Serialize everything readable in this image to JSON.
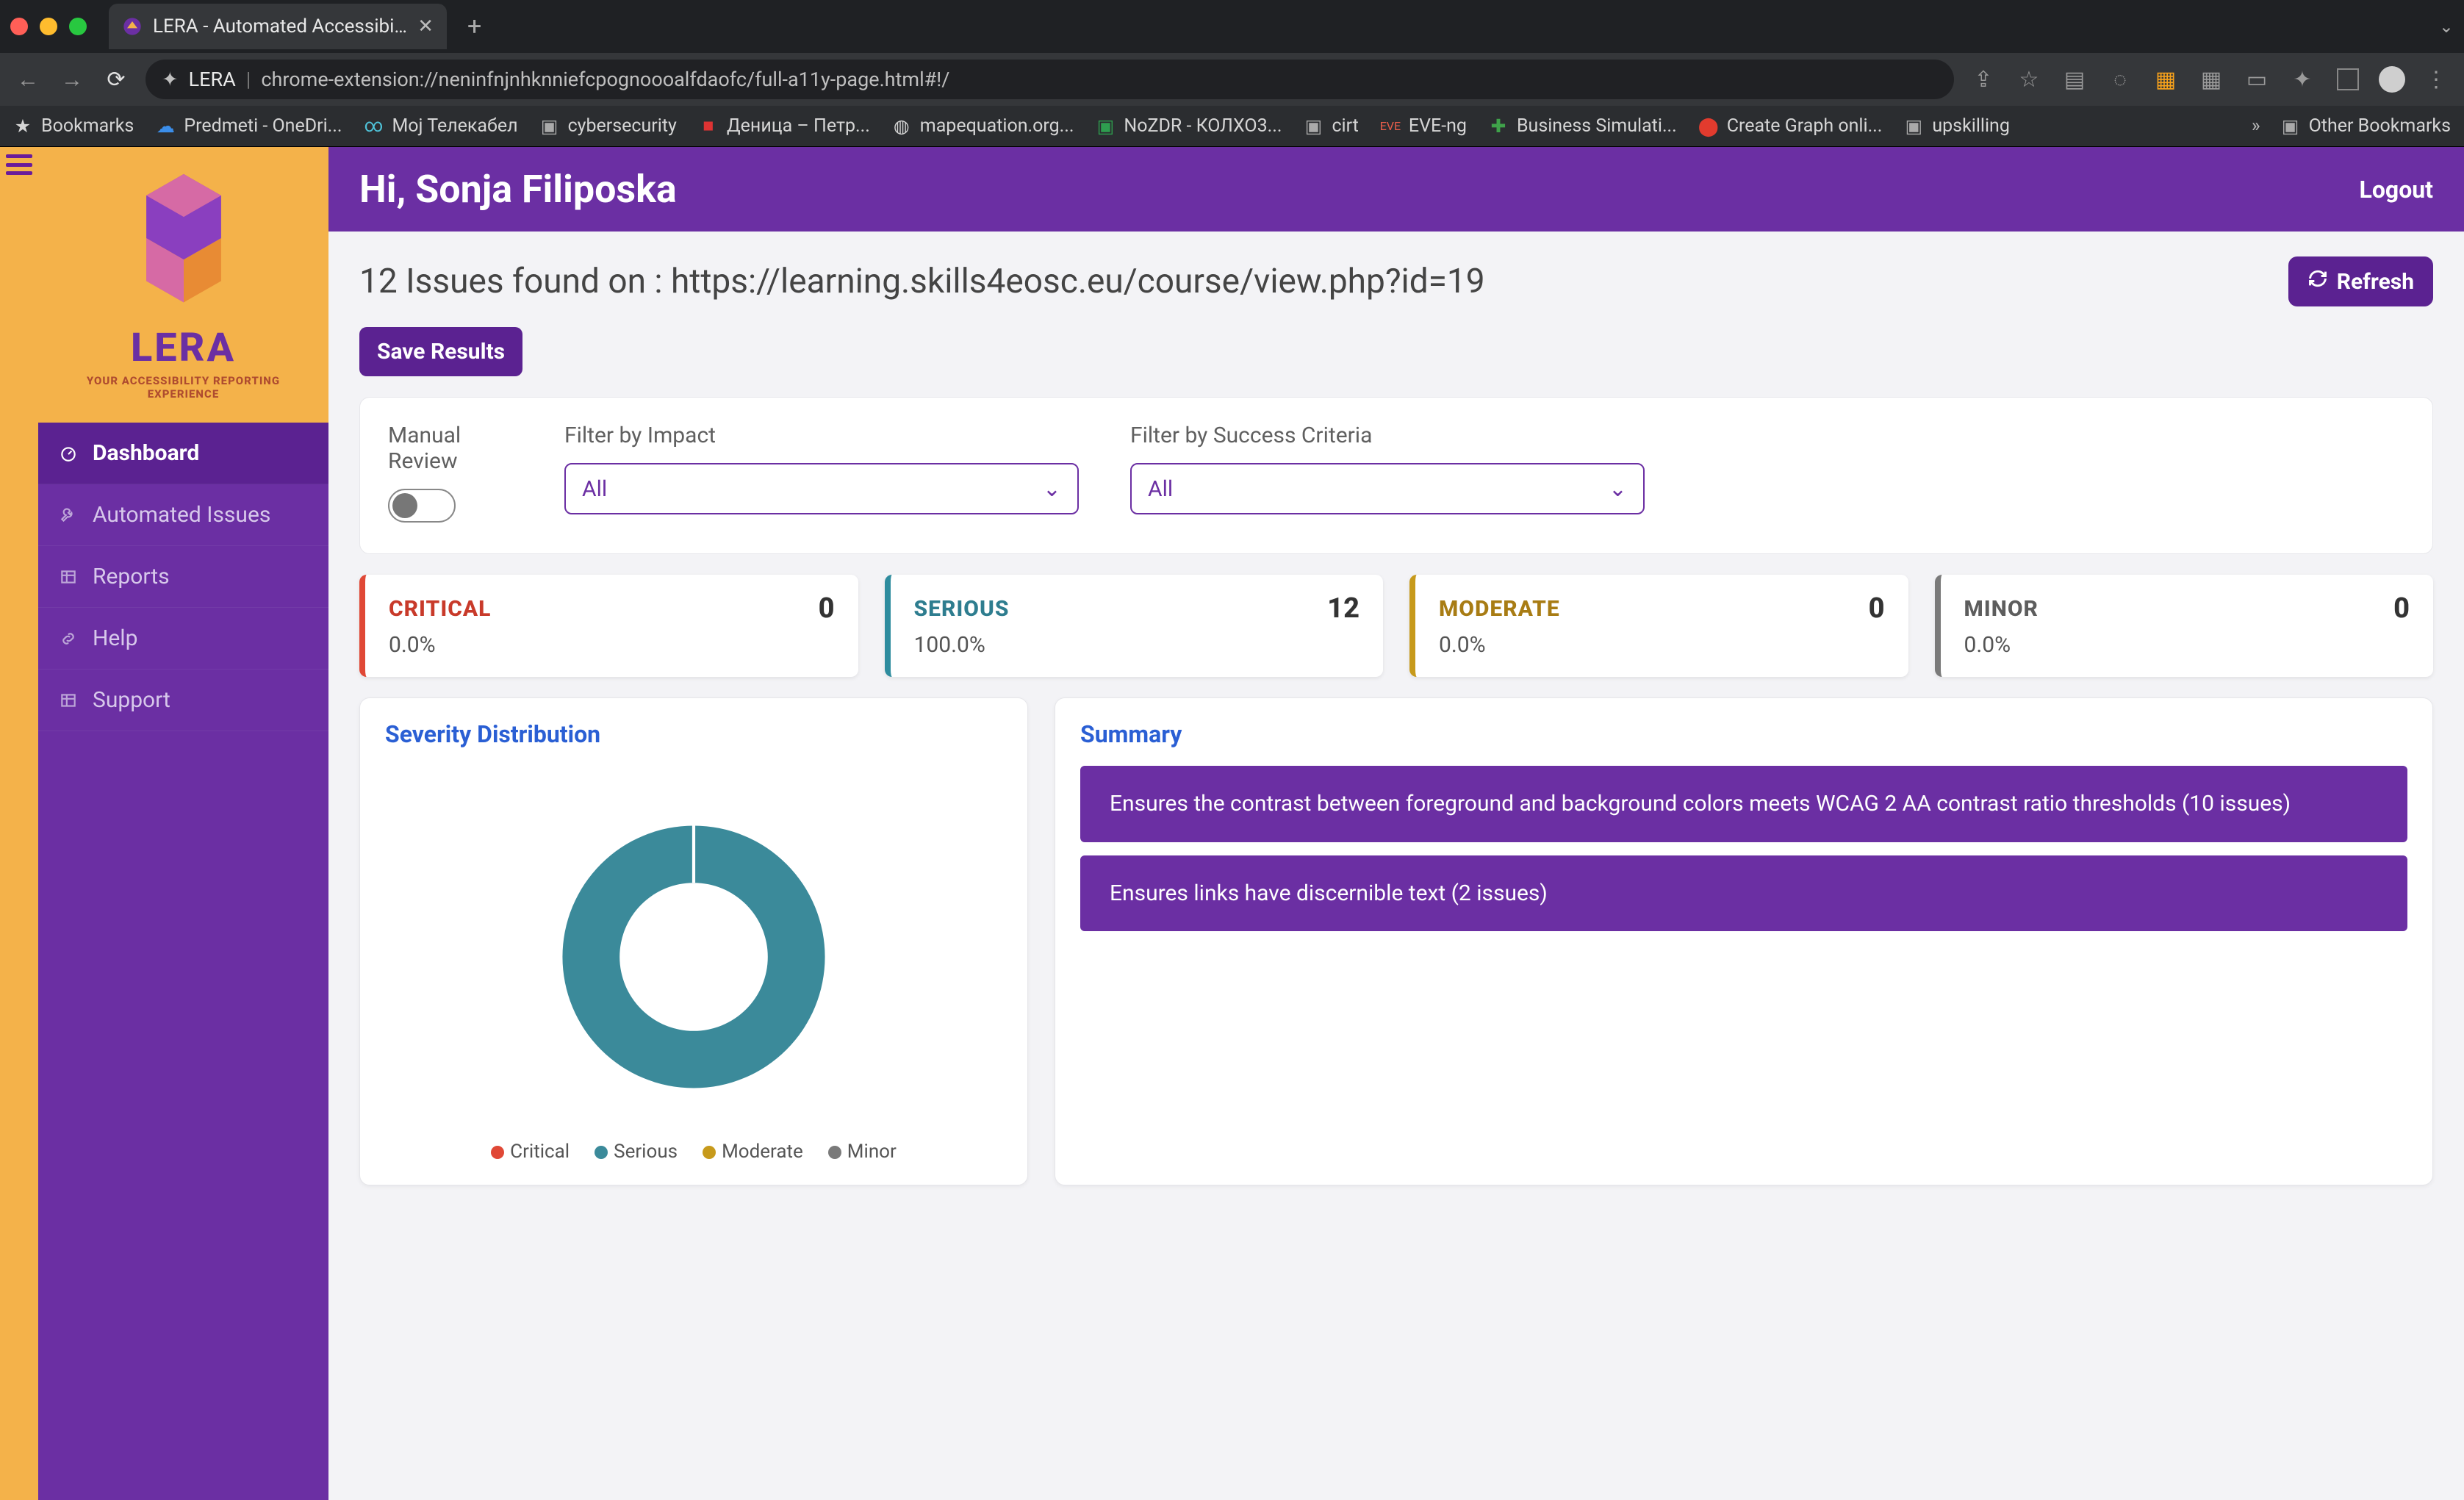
{
  "browser": {
    "tab_title": "LERA - Automated Accessibilit",
    "address_prefix": "LERA",
    "address_url": "chrome-extension://neninfnjnhknniefcpognoooalfdaofc/full-a11y-page.html#!/",
    "bookmarks_label": "Bookmarks",
    "bookmarks": [
      "Predmeti - OneDri...",
      "Мој Телекабел",
      "cybersecurity",
      "Деница – Петр...",
      "mapequation.org...",
      "NoZDR - КОЛХО3...",
      "cirt",
      "EVE-ng",
      "Business Simulati...",
      "Create Graph onli...",
      "upskilling"
    ],
    "other_bookmarks": "Other Bookmarks"
  },
  "brand": {
    "name": "LERA",
    "tagline": "YOUR ACCESSIBILITY REPORTING EXPERIENCE"
  },
  "sidebar": {
    "items": [
      {
        "label": "Dashboard"
      },
      {
        "label": "Automated Issues"
      },
      {
        "label": "Reports"
      },
      {
        "label": "Help"
      },
      {
        "label": "Support"
      }
    ]
  },
  "header": {
    "greeting": "Hi, Sonja Filiposka",
    "logout": "Logout"
  },
  "page": {
    "title": "12 Issues found on : https://learning.skills4eosc.eu/course/view.php?id=19",
    "refresh": "Refresh",
    "save": "Save Results"
  },
  "filters": {
    "manual_review": "Manual Review",
    "impact_label": "Filter by Impact",
    "impact_value": "All",
    "criteria_label": "Filter by Success Criteria",
    "criteria_value": "All"
  },
  "stats": {
    "critical": {
      "name": "CRITICAL",
      "count": "0",
      "pct": "0.0%"
    },
    "serious": {
      "name": "SERIOUS",
      "count": "12",
      "pct": "100.0%"
    },
    "moderate": {
      "name": "MODERATE",
      "count": "0",
      "pct": "0.0%"
    },
    "minor": {
      "name": "MINOR",
      "count": "0",
      "pct": "0.0%"
    }
  },
  "severity": {
    "title": "Severity Distribution",
    "legend": {
      "critical": "Critical",
      "serious": "Serious",
      "moderate": "Moderate",
      "minor": "Minor"
    }
  },
  "summary": {
    "title": "Summary",
    "items": [
      "Ensures the contrast between foreground and background colors meets WCAG 2 AA contrast ratio thresholds (10 issues)",
      "Ensures links have discernible text (2 issues)"
    ]
  },
  "chart_data": {
    "type": "pie",
    "title": "Severity Distribution",
    "categories": [
      "Critical",
      "Serious",
      "Moderate",
      "Minor"
    ],
    "values": [
      0,
      12,
      0,
      0
    ],
    "series_colors": [
      "#e04836",
      "#3b8a9a",
      "#c79a1b",
      "#7a7a7a"
    ]
  }
}
